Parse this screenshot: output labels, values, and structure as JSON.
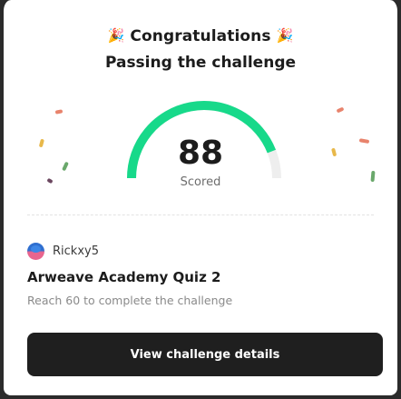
{
  "header": {
    "emoji": "🎉",
    "title": "Congratulations",
    "subtitle": "Passing the challenge"
  },
  "score": {
    "value": "88",
    "label": "Scored",
    "fraction": 0.88,
    "fill_color": "#17d98a",
    "track_color": "#eeeeee"
  },
  "challenge": {
    "username": "Rickxy5",
    "quiz_title": "Arweave Academy Quiz 2",
    "requirement": "Reach 60 to complete the challenge"
  },
  "actions": {
    "view_details_label": "View challenge details"
  },
  "colors": {
    "confetti": [
      "#e8836c",
      "#e8b84a",
      "#6aa86b",
      "#6b4760"
    ]
  }
}
